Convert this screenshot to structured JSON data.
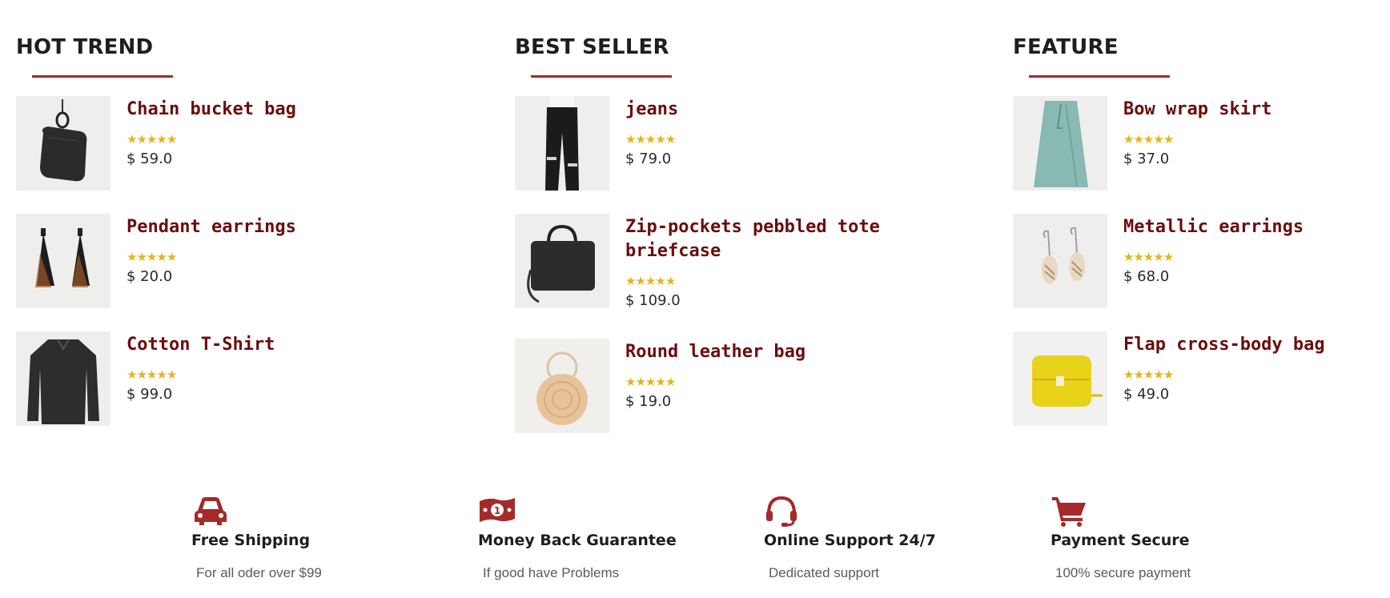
{
  "colors": {
    "accent": "#a52a2a",
    "product_name": "#6b0d0d",
    "star": "#e2b51e"
  },
  "columns": [
    {
      "title": "HOT TREND",
      "products": [
        {
          "name": "Chain bucket bag",
          "rating": 5,
          "price": "$ 59.0",
          "image": "black-chain-bucket-bag"
        },
        {
          "name": "Pendant earrings",
          "rating": 5,
          "price": "$ 20.0",
          "image": "tassel-pendant-earrings"
        },
        {
          "name": "Cotton T-Shirt",
          "rating": 5,
          "price": "$ 99.0",
          "image": "dark-cotton-shirt"
        }
      ]
    },
    {
      "title": "BEST SELLER",
      "products": [
        {
          "name": "jeans",
          "rating": 5,
          "price": "$ 79.0",
          "image": "black-ripped-jeans"
        },
        {
          "name": "Zip-pockets pebbled tote briefcase",
          "rating": 5,
          "price": "$ 109.0",
          "image": "black-briefcase"
        },
        {
          "name": "Round leather bag",
          "rating": 5,
          "price": "$ 19.0",
          "image": "round-straw-bag"
        }
      ]
    },
    {
      "title": "FEATURE",
      "products": [
        {
          "name": "Bow wrap skirt",
          "rating": 5,
          "price": "$ 37.0",
          "image": "mint-wrap-skirt"
        },
        {
          "name": "Metallic earrings",
          "rating": 5,
          "price": "$ 68.0",
          "image": "shell-hoop-earrings"
        },
        {
          "name": "Flap cross-body bag",
          "rating": 5,
          "price": "$ 49.0",
          "image": "yellow-crossbody-bag"
        }
      ]
    }
  ],
  "features": [
    {
      "icon": "car-icon",
      "title": "Free Shipping",
      "desc": "For all oder over $99"
    },
    {
      "icon": "money-icon",
      "title": "Money Back Guarantee",
      "desc": "If good have Problems"
    },
    {
      "icon": "headset-icon",
      "title": "Online Support 24/7",
      "desc": "Dedicated support"
    },
    {
      "icon": "cart-icon",
      "title": "Payment Secure",
      "desc": "100% secure payment"
    }
  ]
}
